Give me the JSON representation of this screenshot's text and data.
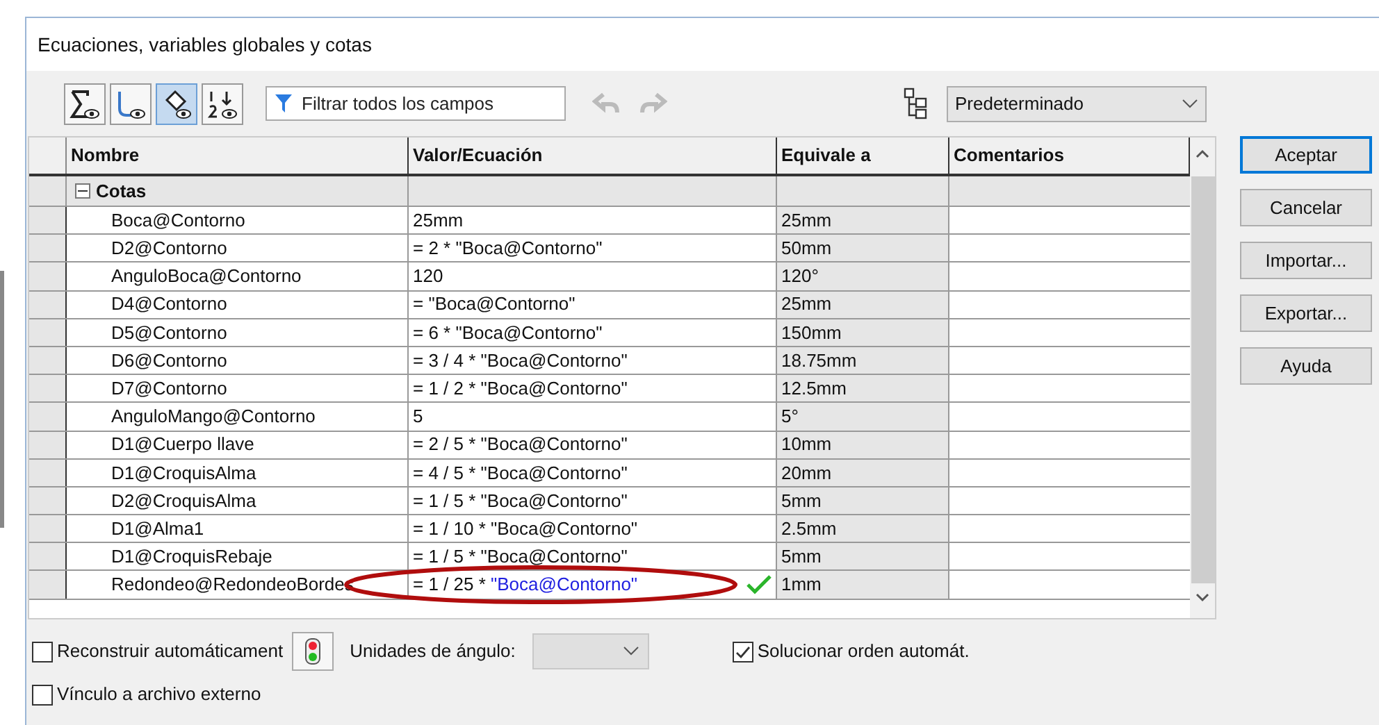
{
  "window": {
    "title": "Ecuaciones, variables globales y cotas"
  },
  "toolbar": {
    "view_buttons": [
      {
        "selected": false
      },
      {
        "selected": false
      },
      {
        "selected": true
      },
      {
        "selected": false
      }
    ],
    "filter": {
      "placeholder": "Filtrar todos los campos"
    },
    "undo_disabled": true,
    "redo_disabled": true,
    "configuration": "Predeterminado"
  },
  "table": {
    "columns": [
      "Nombre",
      "Valor/Ecuación",
      "Equivale a",
      "Comentarios"
    ],
    "group": {
      "label": "Cotas",
      "expanded": true
    },
    "rows": [
      {
        "kind": "plain",
        "name": "Boca@Contorno",
        "value": "25mm",
        "result": "25mm"
      },
      {
        "kind": "plain",
        "name": "D2@Contorno",
        "value": "= 2 * \"Boca@Contorno\"",
        "result": "50mm"
      },
      {
        "kind": "plain",
        "name": "AnguloBoca@Contorno",
        "value": "120",
        "result": "120°"
      },
      {
        "kind": "plain",
        "name": "D4@Contorno",
        "value": "= \"Boca@Contorno\"",
        "result": "25mm"
      },
      {
        "kind": "plain",
        "name": "D5@Contorno",
        "value": "= 6 * \"Boca@Contorno\"",
        "result": "150mm"
      },
      {
        "kind": "plain",
        "name": "D6@Contorno",
        "value": "= 3 / 4 * \"Boca@Contorno\"",
        "result": "18.75mm"
      },
      {
        "kind": "plain",
        "name": "D7@Contorno",
        "value": "= 1 / 2 * \"Boca@Contorno\"",
        "result": "12.5mm"
      },
      {
        "kind": "plain",
        "name": "AnguloMango@Contorno",
        "value": "5",
        "result": "5°"
      },
      {
        "kind": "plain",
        "name": "D1@Cuerpo llave",
        "value": "= 2 / 5 * \"Boca@Contorno\"",
        "result": "10mm"
      },
      {
        "kind": "plain",
        "name": "D1@CroquisAlma",
        "value": "= 4 / 5 * \"Boca@Contorno\"",
        "result": "20mm"
      },
      {
        "kind": "plain",
        "name": "D2@CroquisAlma",
        "value": "= 1 / 5 * \"Boca@Contorno\"",
        "result": "5mm"
      },
      {
        "kind": "plain",
        "name": "D1@Alma1",
        "value": "= 1 / 10 * \"Boca@Contorno\"",
        "result": "2.5mm"
      },
      {
        "kind": "plain",
        "name": "D1@CroquisRebaje",
        "value": "= 1 / 5 * \"Boca@Contorno\"",
        "result": "5mm"
      },
      {
        "kind": "editing",
        "name": "Redondeo@RedondeoBordes",
        "value": "= 1 / 25 * ",
        "reference": "\"Boca@Contorno\"",
        "valid": true,
        "highlighted": true,
        "result": "1mm"
      }
    ]
  },
  "buttons": [
    "Aceptar",
    "Cancelar",
    "Importar...",
    "Exportar...",
    "Ayuda"
  ],
  "options": {
    "auto_rebuild": {
      "label": "Reconstruir automáticament",
      "checked": false
    },
    "angle_units": {
      "label": "Unidades de ángulo:",
      "disabled": true
    },
    "auto_order": {
      "label": "Solucionar orden automát.",
      "checked": true
    },
    "external_link": {
      "label": "Vínculo a archivo externo",
      "checked": false
    }
  }
}
